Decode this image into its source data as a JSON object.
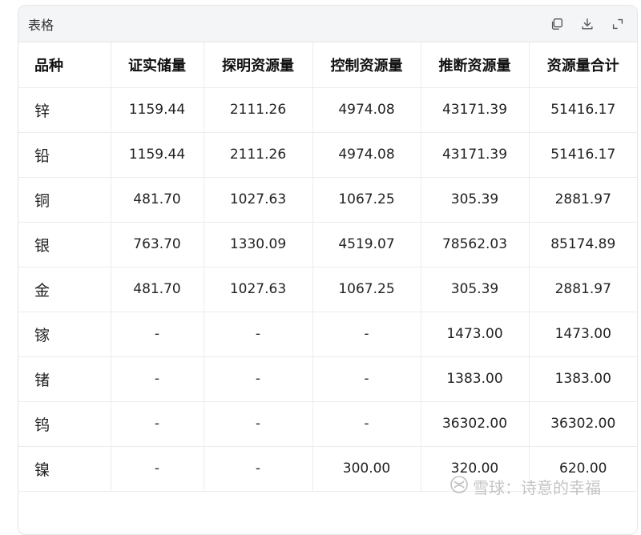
{
  "card": {
    "title": "表格",
    "icons": [
      "copy-icon",
      "download-icon",
      "expand-icon"
    ]
  },
  "table": {
    "headers": [
      "品种",
      "证实储量",
      "探明资源量",
      "控制资源量",
      "推断资源量",
      "资源量合计"
    ],
    "rows": [
      [
        "锌",
        "1159.44",
        "2111.26",
        "4974.08",
        "43171.39",
        "51416.17"
      ],
      [
        "铅",
        "1159.44",
        "2111.26",
        "4974.08",
        "43171.39",
        "51416.17"
      ],
      [
        "铜",
        "481.70",
        "1027.63",
        "1067.25",
        "305.39",
        "2881.97"
      ],
      [
        "银",
        "763.70",
        "1330.09",
        "4519.07",
        "78562.03",
        "85174.89"
      ],
      [
        "金",
        "481.70",
        "1027.63",
        "1067.25",
        "305.39",
        "2881.97"
      ],
      [
        "镓",
        "-",
        "-",
        "-",
        "1473.00",
        "1473.00"
      ],
      [
        "锗",
        "-",
        "-",
        "-",
        "1383.00",
        "1383.00"
      ],
      [
        "钨",
        "-",
        "-",
        "-",
        "36302.00",
        "36302.00"
      ],
      [
        "镍",
        "-",
        "-",
        "300.00",
        "320.00",
        "620.00"
      ]
    ]
  },
  "watermark": {
    "text": "雪球：诗意的幸福",
    "icon": "snowball-logo-icon"
  }
}
